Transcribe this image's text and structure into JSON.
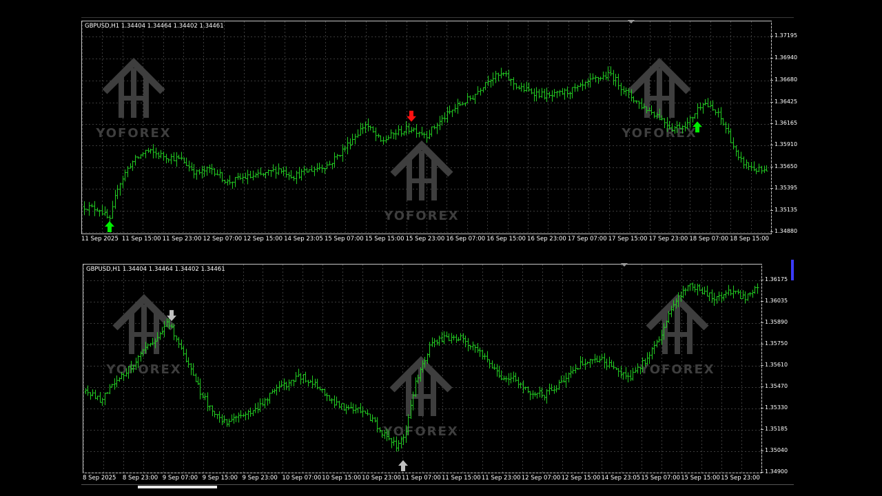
{
  "watermark": {
    "text": "YOFOREX"
  },
  "colors": {
    "background": "#000000",
    "candle": "#22cc22",
    "grid": "#3c3c3c",
    "buy": "#00ee00",
    "sell": "#ff1111",
    "neutral": "#c0c0c0"
  },
  "chart_data": [
    {
      "type": "candlestick",
      "symbol": "GBPUSD,H1",
      "title": "GBPUSD,H1  1.34404 1.34464 1.34402 1.34461",
      "y_ticks": [
        "1.37195",
        "1.36940",
        "1.36680",
        "1.36425",
        "1.36165",
        "1.35910",
        "1.35650",
        "1.35395",
        "1.35135",
        "1.34880"
      ],
      "x_ticks": [
        "11 Sep 2025",
        "11 Sep 15:00",
        "11 Sep 23:00",
        "12 Sep 07:00",
        "12 Sep 15:00",
        "14 Sep 23:05",
        "15 Sep 07:00",
        "15 Sep 15:00",
        "15 Sep 23:00",
        "16 Sep 07:00",
        "16 Sep 15:00",
        "16 Sep 23:00",
        "17 Sep 07:00",
        "17 Sep 15:00",
        "17 Sep 23:00",
        "18 Sep 07:00",
        "18 Sep 15:00"
      ],
      "ylim": [
        1.3488,
        1.3724
      ],
      "path_points": [
        [
          0,
          1.3518
        ],
        [
          6,
          1.3515
        ],
        [
          10,
          1.3502
        ],
        [
          13,
          1.354
        ],
        [
          18,
          1.3565
        ],
        [
          24,
          1.358
        ],
        [
          30,
          1.3575
        ],
        [
          38,
          1.357
        ],
        [
          44,
          1.3555
        ],
        [
          50,
          1.356
        ],
        [
          56,
          1.3545
        ],
        [
          62,
          1.355
        ],
        [
          70,
          1.3553
        ],
        [
          76,
          1.356
        ],
        [
          82,
          1.3552
        ],
        [
          90,
          1.356
        ],
        [
          96,
          1.3565
        ],
        [
          104,
          1.359
        ],
        [
          110,
          1.361
        ],
        [
          116,
          1.359
        ],
        [
          122,
          1.36
        ],
        [
          128,
          1.3605
        ],
        [
          134,
          1.3598
        ],
        [
          140,
          1.3615
        ],
        [
          146,
          1.363
        ],
        [
          152,
          1.364
        ],
        [
          158,
          1.366
        ],
        [
          164,
          1.3665
        ],
        [
          170,
          1.365
        ],
        [
          176,
          1.3645
        ],
        [
          182,
          1.364
        ],
        [
          188,
          1.3645
        ],
        [
          194,
          1.365
        ],
        [
          200,
          1.366
        ],
        [
          206,
          1.3665
        ],
        [
          212,
          1.3645
        ],
        [
          218,
          1.363
        ],
        [
          224,
          1.362
        ],
        [
          230,
          1.3605
        ],
        [
          236,
          1.361
        ],
        [
          242,
          1.3635
        ],
        [
          248,
          1.362
        ],
        [
          252,
          1.36
        ],
        [
          256,
          1.357
        ],
        [
          262,
          1.356
        ],
        [
          268,
          1.3555
        ]
      ],
      "candle_count": 268,
      "arrows": [
        {
          "type": "buy",
          "color": "#00ee00",
          "index": 10,
          "price": 1.3488
        },
        {
          "type": "sell",
          "color": "#ff1111",
          "index": 128,
          "price": 1.362
        },
        {
          "type": "buy",
          "color": "#00ee00",
          "index": 240,
          "price": 1.3605
        }
      ]
    },
    {
      "type": "candlestick",
      "symbol": "GBPUSD,H1",
      "title": "GBPUSD,H1  1.34404 1.34464 1.34402 1.34461",
      "y_ticks": [
        "1.36175",
        "1.36035",
        "1.35890",
        "1.35750",
        "1.35610",
        "1.35470",
        "1.35330",
        "1.35185",
        "1.35040",
        "1.34900"
      ],
      "x_ticks": [
        "8 Sep 2025",
        "8 Sep 23:00",
        "9 Sep 07:00",
        "9 Sep 15:00",
        "9 Sep 23:00",
        "10 Sep 07:00",
        "10 Sep 15:00",
        "10 Sep 23:00",
        "11 Sep 07:00",
        "11 Sep 15:00",
        "11 Sep 23:00",
        "12 Sep 07:00",
        "12 Sep 15:00",
        "14 Sep 23:05",
        "15 Sep 07:00",
        "15 Sep 15:00",
        "15 Sep 23:00"
      ],
      "ylim": [
        1.3488,
        1.3622
      ],
      "path_points": [
        [
          0,
          1.354
        ],
        [
          6,
          1.3535
        ],
        [
          12,
          1.3545
        ],
        [
          18,
          1.3555
        ],
        [
          24,
          1.3565
        ],
        [
          30,
          1.3575
        ],
        [
          34,
          1.3585
        ],
        [
          38,
          1.3575
        ],
        [
          42,
          1.356
        ],
        [
          48,
          1.354
        ],
        [
          54,
          1.3525
        ],
        [
          60,
          1.352
        ],
        [
          66,
          1.3525
        ],
        [
          72,
          1.353
        ],
        [
          78,
          1.354
        ],
        [
          84,
          1.3545
        ],
        [
          90,
          1.355
        ],
        [
          96,
          1.3545
        ],
        [
          102,
          1.3535
        ],
        [
          108,
          1.353
        ],
        [
          114,
          1.3528
        ],
        [
          120,
          1.3522
        ],
        [
          126,
          1.351
        ],
        [
          130,
          1.3505
        ],
        [
          134,
          1.3515
        ],
        [
          138,
          1.3545
        ],
        [
          144,
          1.357
        ],
        [
          150,
          1.3575
        ],
        [
          156,
          1.3575
        ],
        [
          162,
          1.357
        ],
        [
          168,
          1.356
        ],
        [
          174,
          1.355
        ],
        [
          180,
          1.3548
        ],
        [
          186,
          1.354
        ],
        [
          192,
          1.3538
        ],
        [
          198,
          1.3545
        ],
        [
          204,
          1.3555
        ],
        [
          210,
          1.356
        ],
        [
          216,
          1.356
        ],
        [
          222,
          1.3555
        ],
        [
          228,
          1.355
        ],
        [
          234,
          1.356
        ],
        [
          240,
          1.3575
        ],
        [
          246,
          1.3595
        ],
        [
          252,
          1.361
        ],
        [
          258,
          1.3605
        ],
        [
          264,
          1.36
        ],
        [
          270,
          1.3605
        ],
        [
          276,
          1.36
        ],
        [
          282,
          1.361
        ]
      ],
      "candle_count": 282,
      "arrows": [
        {
          "type": "sell",
          "color": "#c0c0c0",
          "index": 36,
          "price": 1.359
        },
        {
          "type": "buy",
          "color": "#c0c0c0",
          "index": 133,
          "price": 1.3489
        }
      ]
    }
  ]
}
